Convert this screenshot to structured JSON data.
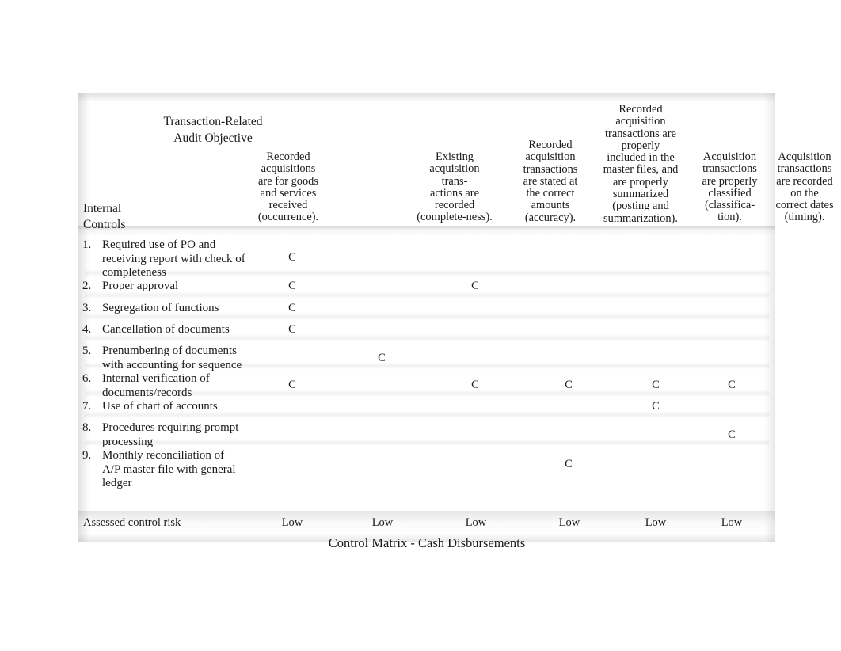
{
  "slide": {
    "caption": "Control Matrix - Cash Disbursements",
    "corner": {
      "objective_label": "Transaction-Related\nAudit Objective",
      "controls_label": "Internal\nControls"
    },
    "columns": [
      {
        "id": "occurrence",
        "header": "Recorded\nacquisitions\nare for goods\nand services\nreceived\n(occurrence)."
      },
      {
        "id": "completeness",
        "header": "Existing\nacquisition\ntrans-\nactions are\nrecorded\n(complete-ness)."
      },
      {
        "id": "accuracy",
        "header": "Recorded\nacquisition\ntransactions\nare stated at\nthe correct\namounts\n(accuracy)."
      },
      {
        "id": "posting-summarization",
        "header": "Recorded\nacquisition\ntransactions are\nproperly\nincluded in the\nmaster files, and\nare properly\nsummarized\n(posting and\nsummarization)."
      },
      {
        "id": "classification",
        "header": "Acquisition\ntransactions\nare properly\nclassified\n(classifica-\ntion)."
      },
      {
        "id": "timing",
        "header": "Acquisition\ntransactions\nare recorded\non the\ncorrect dates\n(timing)."
      }
    ],
    "rows": [
      {
        "num": "1.",
        "label": "Required use of PO and\nreceiving report with check of\ncompleteness",
        "marks": [
          "C",
          "",
          "",
          "",
          "",
          ""
        ]
      },
      {
        "num": "2.",
        "label": "Proper approval",
        "marks": [
          "C",
          "",
          "C",
          "",
          "",
          ""
        ]
      },
      {
        "num": "3.",
        "label": "Segregation of functions",
        "marks": [
          "C",
          "",
          "",
          "",
          "",
          ""
        ]
      },
      {
        "num": "4.",
        "label": "Cancellation of documents",
        "marks": [
          "C",
          "",
          "",
          "",
          "",
          ""
        ]
      },
      {
        "num": "5.",
        "label": "Prenumbering of documents\nwith accounting for sequence",
        "marks": [
          "",
          "C",
          "",
          "",
          "",
          ""
        ]
      },
      {
        "num": "6.",
        "label": "Internal verification of\ndocuments/records",
        "marks": [
          "C",
          "",
          "C",
          "C",
          "C",
          "C"
        ]
      },
      {
        "num": "7.",
        "label": "Use of chart of accounts",
        "marks": [
          "",
          "",
          "",
          "",
          "C",
          ""
        ]
      },
      {
        "num": "8.",
        "label": "Procedures requiring prompt\nprocessing",
        "marks": [
          "",
          "",
          "",
          "",
          "",
          "C"
        ]
      },
      {
        "num": "9.",
        "label": "Monthly reconciliation of\nA/P master file with general\nledger",
        "marks": [
          "",
          "",
          "",
          "C",
          "",
          ""
        ]
      }
    ],
    "assessed_risk": {
      "label": "Assessed control risk",
      "values": [
        "Low",
        "Low",
        "Low",
        "Low",
        "Low",
        "Low"
      ]
    }
  }
}
